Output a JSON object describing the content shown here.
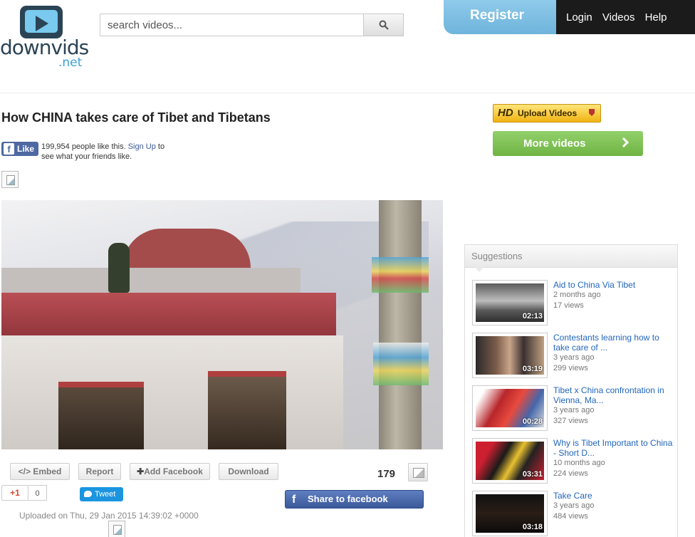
{
  "header": {
    "logo_word": "downvids",
    "logo_tld": ".net",
    "search_placeholder": "search videos...",
    "register_label": "Register",
    "nav": [
      "Login",
      "Videos",
      "Help"
    ]
  },
  "video": {
    "title": "How CHINA takes care of Tibet and Tibetans",
    "like_label": "Like",
    "like_text": "199,954 people like this.",
    "like_signup": "Sign Up",
    "like_suffix": "to see what your friends like.",
    "toolbar": {
      "embed": "Embed",
      "report": "Report",
      "add_facebook": "Add Facebook",
      "download": "Download"
    },
    "views": "179",
    "gplus_label": "+1",
    "gplus_count": "0",
    "tweet_label": "Tweet",
    "share_fb_label": "Share to facebook",
    "uploaded": "Uploaded on Thu, 29 Jan 2015 14:39:02 +0000"
  },
  "sidebar": {
    "hd_upload_prefix": "HD",
    "hd_upload_label": "Upload Videos",
    "more_videos_label": "More videos",
    "suggestions_header": "Suggestions",
    "items": [
      {
        "title": "Aid to China Via Tibet",
        "age": "2 months ago",
        "views": "17 views",
        "duration": "02:13"
      },
      {
        "title": "Contestants learning how to take care of ...",
        "age": "3 years ago",
        "views": "299 views",
        "duration": "03:19"
      },
      {
        "title": "Tibet x China confrontation in Vienna, Ma...",
        "age": "3 years ago",
        "views": "327 views",
        "duration": "00:28"
      },
      {
        "title": "Why is Tibet Important to China - Short D...",
        "age": "10 months ago",
        "views": "224 views",
        "duration": "03:31"
      },
      {
        "title": "Take Care",
        "age": "3 years ago",
        "views": "484 views",
        "duration": "03:18"
      }
    ]
  },
  "colors": {
    "brand_dark": "#2b4455",
    "brand_light": "#3aa0d8",
    "register_blue": "#7fbfe3",
    "facebook_blue": "#3b5998",
    "link_blue": "#2266bb",
    "more_green": "#7fc255"
  }
}
